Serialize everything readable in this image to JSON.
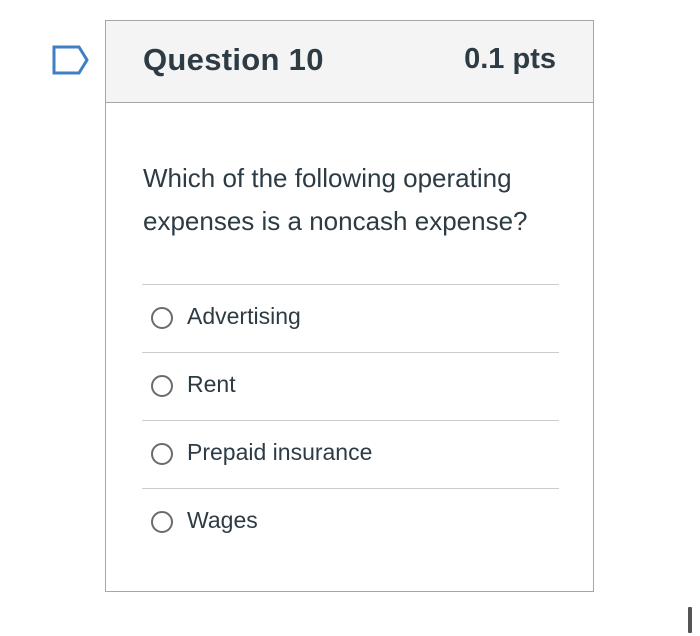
{
  "question": {
    "title": "Question 10",
    "points": "0.1 pts",
    "text": "Which of the following operating expenses is a noncash expense?",
    "answers": [
      {
        "label": "Advertising"
      },
      {
        "label": "Rent"
      },
      {
        "label": "Prepaid insurance"
      },
      {
        "label": "Wages"
      }
    ]
  },
  "icons": {
    "flag": "flag-icon",
    "radio": "radio-unchecked-icon"
  },
  "colors": {
    "flag_outline": "#3f7fc4",
    "header_bg": "#f4f4f4",
    "border": "#a6a6a6",
    "text": "#2d3b45"
  }
}
